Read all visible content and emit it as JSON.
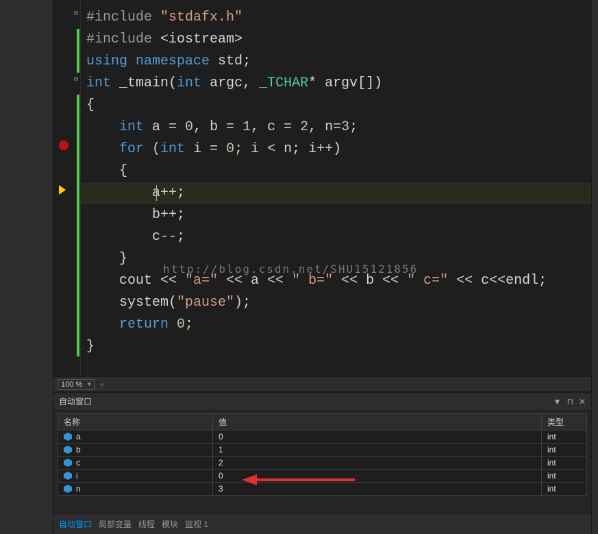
{
  "code": {
    "lines": [
      {
        "indent": 0,
        "tokens": [
          [
            "inc",
            "#include "
          ],
          [
            "str",
            "\"stdafx.h\""
          ]
        ]
      },
      {
        "indent": 0,
        "tokens": [
          [
            "inc",
            "#include "
          ],
          [
            "ident",
            "<iostream>"
          ]
        ]
      },
      {
        "indent": 0,
        "tokens": [
          [
            "kw",
            "using "
          ],
          [
            "kw",
            "namespace "
          ],
          [
            "ident",
            "std"
          ],
          [
            "ident",
            ";"
          ]
        ]
      },
      {
        "indent": 0,
        "tokens": [
          [
            "kw",
            "int "
          ],
          [
            "ident",
            "_tmain"
          ],
          [
            "ident",
            "("
          ],
          [
            "kw",
            "int "
          ],
          [
            "ident",
            "argc, "
          ],
          [
            "type",
            "_TCHAR"
          ],
          [
            "ident",
            "* argv[])"
          ]
        ]
      },
      {
        "indent": 0,
        "tokens": [
          [
            "ident",
            "{"
          ]
        ]
      },
      {
        "indent": 1,
        "tokens": [
          [
            "kw",
            "int "
          ],
          [
            "ident",
            "a = "
          ],
          [
            "num",
            "0"
          ],
          [
            "ident",
            ", b = "
          ],
          [
            "num",
            "1"
          ],
          [
            "ident",
            ", c = "
          ],
          [
            "num",
            "2"
          ],
          [
            "ident",
            ", n="
          ],
          [
            "num",
            "3"
          ],
          [
            "ident",
            ";"
          ]
        ]
      },
      {
        "indent": 1,
        "tokens": [
          [
            "kw",
            "for "
          ],
          [
            "ident",
            "("
          ],
          [
            "kw",
            "int "
          ],
          [
            "ident",
            "i = "
          ],
          [
            "num",
            "0"
          ],
          [
            "ident",
            "; i < n; i++)"
          ]
        ]
      },
      {
        "indent": 1,
        "tokens": [
          [
            "ident",
            "{"
          ]
        ]
      },
      {
        "indent": 2,
        "tokens": [
          [
            "ident",
            "a++;"
          ]
        ],
        "current": true
      },
      {
        "indent": 2,
        "tokens": [
          [
            "ident",
            "b++;"
          ]
        ]
      },
      {
        "indent": 2,
        "tokens": [
          [
            "ident",
            "c--;"
          ]
        ]
      },
      {
        "indent": 1,
        "tokens": [
          [
            "ident",
            "}"
          ]
        ]
      },
      {
        "indent": 1,
        "tokens": [
          [
            "ident",
            "cout << "
          ],
          [
            "str",
            "\"a=\""
          ],
          [
            "ident",
            " << a << "
          ],
          [
            "str",
            "\" b=\""
          ],
          [
            "ident",
            " << b << "
          ],
          [
            "str",
            "\" c=\""
          ],
          [
            "ident",
            " << c<<endl;"
          ]
        ]
      },
      {
        "indent": 1,
        "tokens": [
          [
            "ident",
            "system("
          ],
          [
            "str",
            "\"pause\""
          ],
          [
            "ident",
            ");"
          ]
        ]
      },
      {
        "indent": 1,
        "tokens": [
          [
            "kw",
            "return "
          ],
          [
            "num",
            "0"
          ],
          [
            "ident",
            ";"
          ]
        ]
      },
      {
        "indent": 0,
        "tokens": [
          [
            "ident",
            "}"
          ]
        ]
      }
    ],
    "watermark": "http://blog.csdn.net/SHU15121856"
  },
  "zoom": {
    "value": "100 %"
  },
  "autos": {
    "title": "自动窗口",
    "headers": {
      "name": "名称",
      "value": "值",
      "type": "类型"
    },
    "rows": [
      {
        "name": "a",
        "value": "0",
        "type": "int",
        "changed": false
      },
      {
        "name": "b",
        "value": "1",
        "type": "int",
        "changed": false
      },
      {
        "name": "c",
        "value": "2",
        "type": "int",
        "changed": false
      },
      {
        "name": "i",
        "value": "0",
        "type": "int",
        "changed": true
      },
      {
        "name": "n",
        "value": "3",
        "type": "int",
        "changed": false
      }
    ]
  },
  "tabs": {
    "items": [
      "自动窗口",
      "局部变量",
      "线程",
      "模块",
      "监视 1"
    ],
    "active": 0
  },
  "titlebar_icons": {
    "menu": "▼",
    "pin": "📌",
    "close": "✕"
  }
}
